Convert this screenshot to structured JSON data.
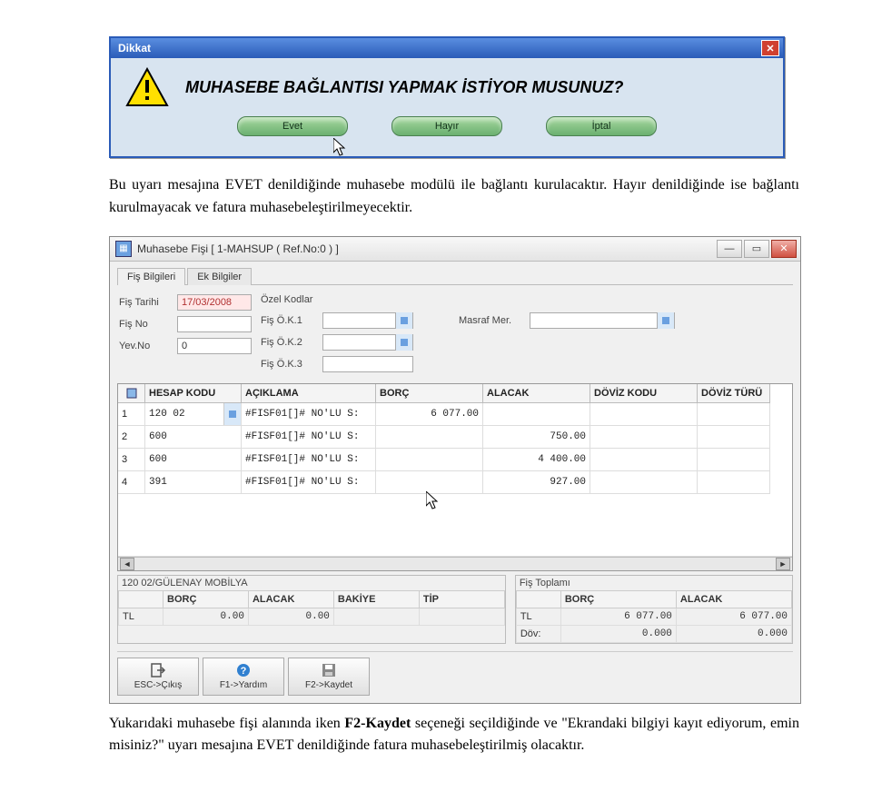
{
  "dialog": {
    "title": "Dikkat",
    "message": "MUHASEBE BAĞLANTISI YAPMAK İSTİYOR MUSUNUZ?",
    "buttons": {
      "yes": "Evet",
      "no": "Hayır",
      "cancel": "İptal"
    }
  },
  "paragraph1": "Bu uyarı mesajına EVET denildiğinde muhasebe modülü ile bağlantı kurulacaktır. Hayır denildiğinde ise bağlantı kurulmayacak ve fatura muhasebeleştirilmeyecektir.",
  "window": {
    "title": "Muhasebe Fişi [ 1-MAHSUP ( Ref.No:0 ) ]",
    "tabs": {
      "t1": "Fiş Bilgileri",
      "t2": "Ek Bilgiler"
    },
    "form": {
      "fis_tarihi_lbl": "Fiş Tarihi",
      "fis_tarihi_val": "17/03/2008",
      "fis_no_lbl": "Fiş No",
      "fis_no_val": "",
      "yev_no_lbl": "Yev.No",
      "yev_no_val": "0",
      "ozel_kodlar_lbl": "Özel Kodlar",
      "fok1_lbl": "Fiş Ö.K.1",
      "fok2_lbl": "Fiş Ö.K.2",
      "fok3_lbl": "Fiş Ö.K.3",
      "masraf_lbl": "Masraf Mer."
    },
    "grid": {
      "headers": {
        "hesap": "HESAP KODU",
        "aciklama": "AÇIKLAMA",
        "borc": "BORÇ",
        "alacak": "ALACAK",
        "doviz_kodu": "DÖVİZ KODU",
        "doviz_turu": "DÖVİZ TÜRÜ"
      },
      "rows": [
        {
          "n": "1",
          "hesap": "120 02",
          "aciklama": "#FISF01[]# NO'LU S:",
          "borc": "6 077.00",
          "alacak": ""
        },
        {
          "n": "2",
          "hesap": "600",
          "aciklama": "#FISF01[]# NO'LU S:",
          "borc": "",
          "alacak": "750.00"
        },
        {
          "n": "3",
          "hesap": "600",
          "aciklama": "#FISF01[]# NO'LU S:",
          "borc": "",
          "alacak": "4 400.00"
        },
        {
          "n": "4",
          "hesap": "391",
          "aciklama": "#FISF01[]# NO'LU S:",
          "borc": "",
          "alacak": "927.00"
        }
      ]
    },
    "account_path": "120 02/GÜLENAY MOBİLYA",
    "totals_left": {
      "h_borc": "BORÇ",
      "h_alacak": "ALACAK",
      "h_bakiye": "BAKİYE",
      "h_tip": "TİP",
      "r_lbl": "TL",
      "r_borc": "0.00",
      "r_alacak": "0.00",
      "r_bakiye": "",
      "r_tip": ""
    },
    "totals_right": {
      "title": "Fiş Toplamı",
      "h_borc": "BORÇ",
      "h_alacak": "ALACAK",
      "r1_lbl": "TL",
      "r1_borc": "6 077.00",
      "r1_alacak": "6 077.00",
      "r2_lbl": "Döv:",
      "r2_borc": "0.000",
      "r2_alacak": "0.000"
    },
    "toolbar": {
      "esc": "ESC->Çıkış",
      "f1": "F1->Yardım",
      "f2": "F2->Kaydet"
    }
  },
  "paragraph2_a": "Yukarıdaki muhasebe fişi alanında iken ",
  "paragraph2_b": "F2-Kaydet",
  "paragraph2_c": " seçeneği seçildiğinde ve \"Ekrandaki bilgiyi kayıt ediyorum, emin misiniz?\" uyarı mesajına EVET denildiğinde fatura muhasebeleştirilmiş olacaktır."
}
